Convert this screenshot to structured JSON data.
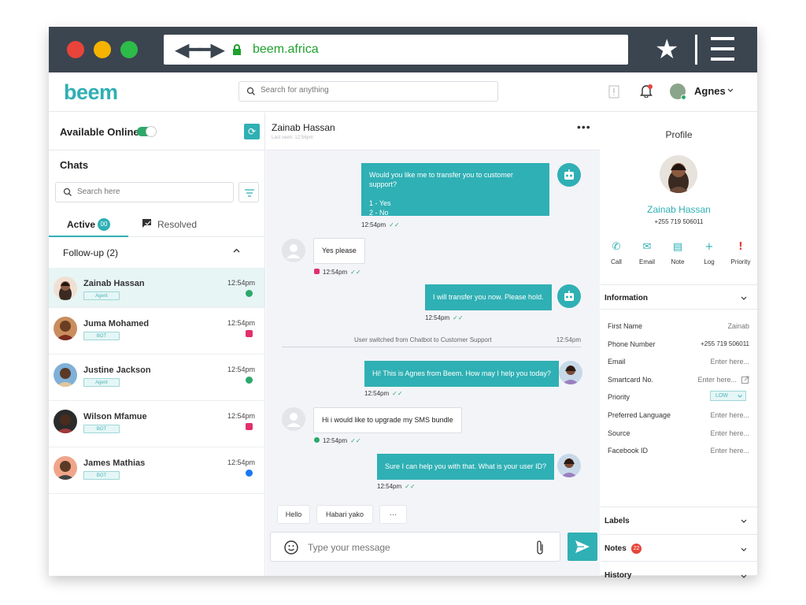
{
  "browser": {
    "domain": "beem.africa",
    "traffic_lights": [
      "#e8443a",
      "#f6b400",
      "#2dbb4a"
    ]
  },
  "app": {
    "logo": "beem",
    "search_placeholder": "Search for anything",
    "agent_name": "Agnes",
    "accent": "#2fb0b4"
  },
  "left": {
    "availability_label": "Available Online",
    "chats_heading": "Chats",
    "search_placeholder": "Search here",
    "tab_active": "Active",
    "tab_active_count": "00",
    "tab_resolved": "Resolved",
    "followup_label": "Follow-up (2)",
    "chats": [
      {
        "name": "Zainab Hassan",
        "tag": "Agent",
        "time": "12:54pm",
        "channel": "whatsapp",
        "selected": true
      },
      {
        "name": "Juma Mohamed",
        "tag": "BOT",
        "time": "12:54pm",
        "channel": "instagram"
      },
      {
        "name": "Justine Jackson",
        "tag": "Agent",
        "time": "12:54pm",
        "channel": "whatsapp"
      },
      {
        "name": "Wilson Mfamue",
        "tag": "BOT",
        "time": "12:54pm",
        "channel": "instagram"
      },
      {
        "name": "James Mathias",
        "tag": "BOT",
        "time": "12:54pm",
        "channel": "messenger"
      }
    ]
  },
  "conversation": {
    "contact_name": "Zainab Hassan",
    "last_seen": "Last seen: 12:54pm",
    "messages": [
      {
        "from": "bot",
        "lines": [
          "Would you like me to transfer you to customer support?",
          "",
          "1 - Yes",
          "2 - No"
        ],
        "time": "12:54pm"
      },
      {
        "from": "customer",
        "text": "Yes please",
        "time": "12:54pm",
        "channel": "instagram"
      },
      {
        "from": "bot",
        "text": "I will transfer you now. Please hold.",
        "time": "12:54pm"
      },
      {
        "from": "agent",
        "text": "Hi! This is Agnes from Beem. How may I help you today?",
        "time": "12:54pm"
      },
      {
        "from": "customer",
        "text": "Hi i would like to upgrade my SMS bundle",
        "time": "12:54pm",
        "channel": "whatsapp"
      },
      {
        "from": "agent",
        "text": "Sure I can help you with that. What is your user ID?",
        "time": "12:54pm"
      }
    ],
    "system_event": {
      "text": "User switched from Chatbot to Customer Support",
      "time": "12:54pm"
    },
    "quick_replies": [
      "Hello",
      "Habari yako",
      "···"
    ],
    "composer_placeholder": "Type your message"
  },
  "profile": {
    "heading": "Profile",
    "name": "Zainab Hassan",
    "phone": "+255 719 506011",
    "actions": [
      "Call",
      "Email",
      "Note",
      "Log",
      "Priority"
    ],
    "information_heading": "Information",
    "fields": [
      {
        "label": "First Name",
        "value": "Zainab"
      },
      {
        "label": "Phone Number",
        "value": "+255 719 506011"
      },
      {
        "label": "Email",
        "value": "Enter here..."
      },
      {
        "label": "Smartcard No.",
        "value": "Enter here..."
      },
      {
        "label": "Priority",
        "value": "LOW"
      },
      {
        "label": "Preferred Language",
        "value": "Enter here..."
      },
      {
        "label": "Source",
        "value": "Enter here..."
      },
      {
        "label": "Facebook ID",
        "value": "Enter here..."
      }
    ],
    "labels_heading": "Labels",
    "notes_heading": "Notes",
    "notes_count": "22",
    "history_heading": "History"
  }
}
